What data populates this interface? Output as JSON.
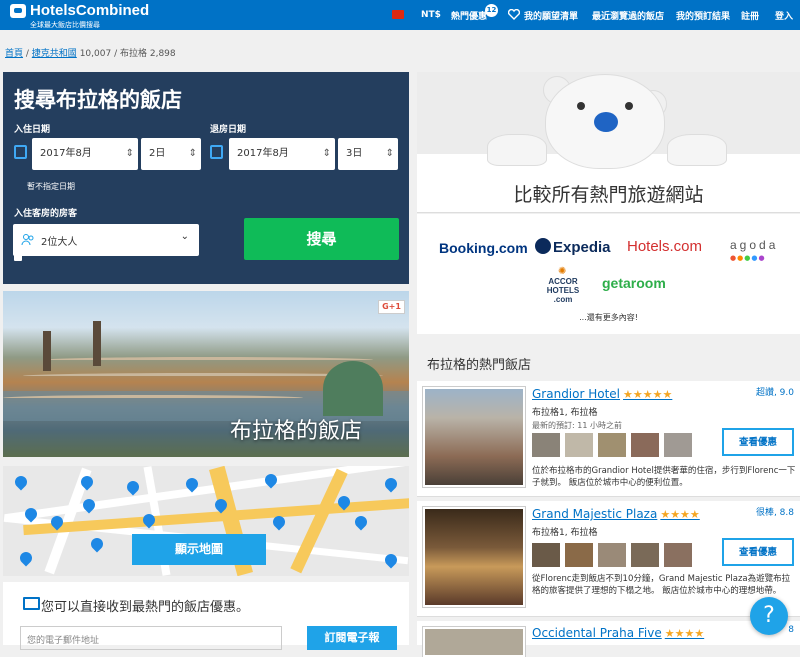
{
  "header": {
    "logo_text": "HotelsCombined",
    "logo_tagline": "全球最大飯店比價搜尋",
    "currency": "NT$",
    "deals_label": "熱門優惠",
    "deals_count": "12",
    "wishlist_label": "我的願望清單",
    "recent_label": "最近瀏覽過的飯店",
    "bookings_label": "我的預訂結果",
    "register_label": "註冊",
    "login_label": "登入"
  },
  "breadcrumb": {
    "home": "首頁",
    "country": "捷克共和國",
    "country_count": "10,007",
    "city": "布拉格",
    "city_count": "2,898"
  },
  "search": {
    "title": "搜尋布拉格的飯店",
    "checkin_label": "入住日期",
    "checkout_label": "退房日期",
    "checkin_month": "2017年8月",
    "checkin_day": "2日",
    "checkout_month": "2017年8月",
    "checkout_day": "3日",
    "flexible_label": "暫不指定日期",
    "guests_label": "入住客房的房客",
    "guests_value": "2位大人",
    "search_button": "搜尋"
  },
  "city_banner": {
    "title": "布拉格的飯店",
    "share": "G+1"
  },
  "map": {
    "show_map_button": "顯示地圖"
  },
  "newsletter": {
    "title": "您可以直接收到最熱門的飯店優惠。",
    "email_placeholder": "您的電子郵件地址",
    "subscribe_button": "訂閱電子報"
  },
  "partners": {
    "heading": "比較所有熱門旅遊網站",
    "logos": [
      "Booking.com",
      "Expedia",
      "Hotels.com",
      "agoda",
      "ACCOR HOTELS .com",
      "getaroom"
    ],
    "more": "...還有更多內容!"
  },
  "popular": {
    "heading": "布拉格的熱門飯店",
    "hotels": [
      {
        "name": "Grandior Hotel",
        "stars": "★★★★★",
        "score": "超讚, 9.0",
        "location": "布拉格1, 布拉格",
        "recent": "最新的預訂: 11 小時之前",
        "description": "位於布拉格市的Grandior Hotel提供奢華的住宿，步行到Florenc一下子就到。 飯店位於城市中心的便利位置。",
        "deal_button": "查看優惠"
      },
      {
        "name": "Grand Majestic Plaza",
        "stars": "★★★★",
        "score": "很棒, 8.8",
        "location": "布拉格1, 布拉格",
        "recent": "",
        "description": "從Florenc走到飯店不到10分鐘，Grand Majestic Plaza為遊覽布拉格的旅客提供了理想的下榻之地。 飯店位於城市中心的理想地帶。",
        "deal_button": "查看優惠"
      },
      {
        "name": "Occidental Praha Five",
        "stars": "★★★★",
        "score": "8",
        "location": "",
        "recent": "",
        "description": "",
        "deal_button": ""
      }
    ]
  },
  "help_button": "?",
  "colors": {
    "brand_blue": "#0072c6",
    "search_panel": "#243e5e",
    "search_green": "#0fbb58",
    "accent_blue": "#1fa3e8",
    "star_gold": "#f5a623"
  }
}
